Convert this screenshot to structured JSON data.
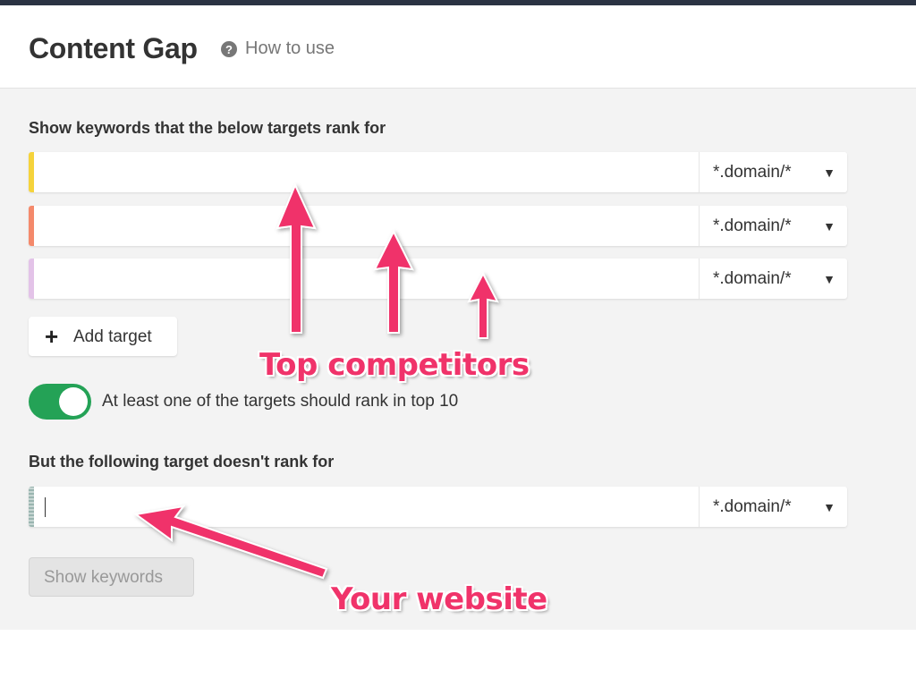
{
  "header": {
    "title": "Content Gap",
    "help_icon": "?",
    "how_to_use": "How to use"
  },
  "section1": {
    "label": "Show keywords that the below targets rank for",
    "targets": [
      {
        "value": "",
        "mode": "*.domain/*",
        "color": "#f5d33b"
      },
      {
        "value": "",
        "mode": "*.domain/*",
        "color": "#f4896b"
      },
      {
        "value": "",
        "mode": "*.domain/*",
        "color": "#e3c3e8"
      }
    ],
    "add_target_icon": "+",
    "add_target_label": "Add target"
  },
  "toggle": {
    "state": "on",
    "label": "At least one of the targets should rank in top 10",
    "color": "#24a256"
  },
  "section2": {
    "label": "But the following target doesn't rank for",
    "target": {
      "value": "",
      "mode": "*.domain/*",
      "color": "#9ab5b0"
    }
  },
  "show_keywords_label": "Show keywords",
  "annotations": {
    "competitors_label": "Top competitors",
    "website_label": "Your website",
    "color": "#f0336a"
  },
  "icons": {
    "dropdown_arrow": "▼"
  }
}
